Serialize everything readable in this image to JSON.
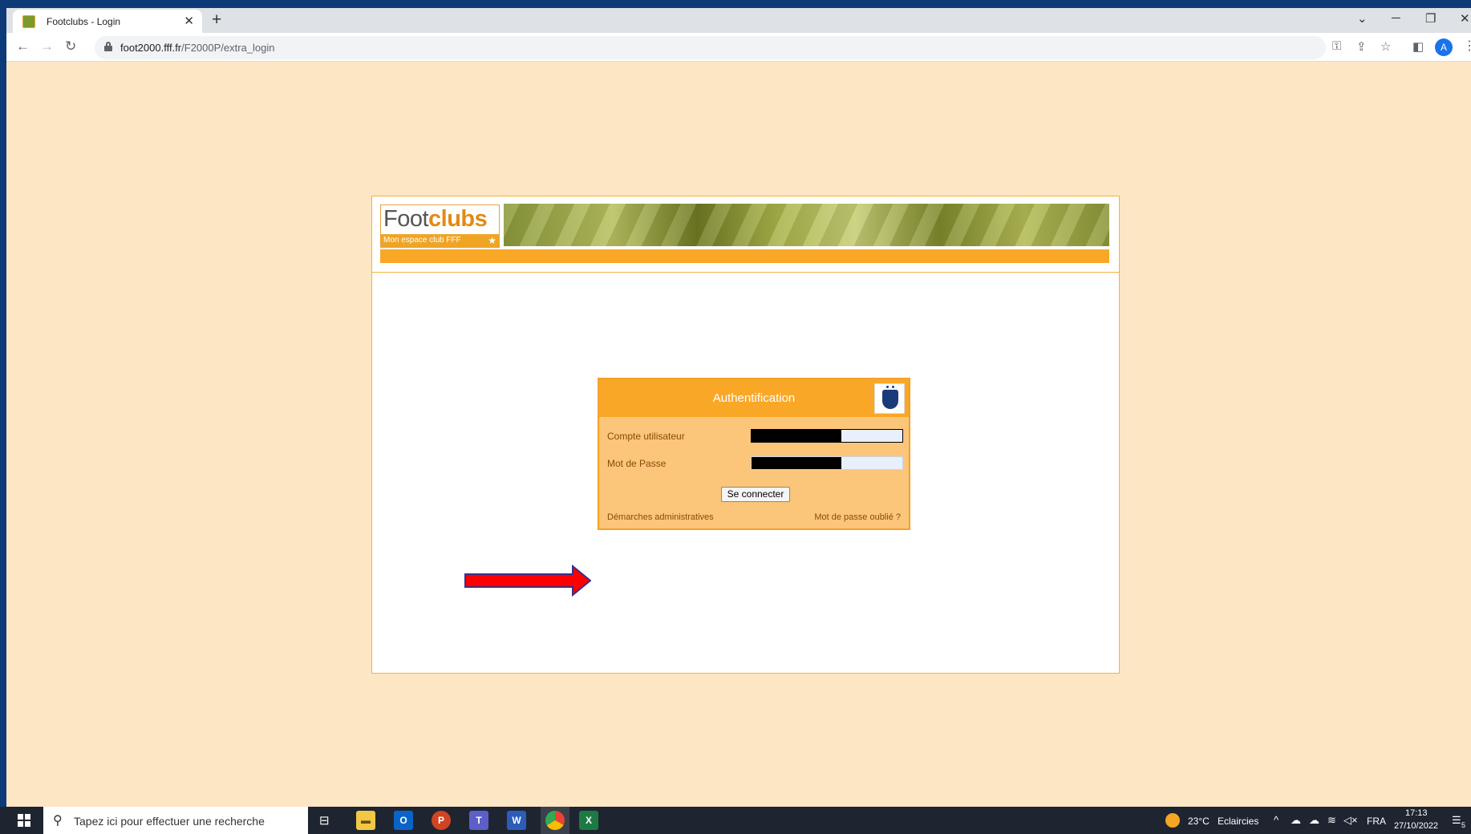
{
  "browser": {
    "tab_title": "Footclubs - Login",
    "tab_close": "✕",
    "new_tab": "+",
    "url_host": "foot2000.fff.fr",
    "url_path": "/F2000P/extra_login",
    "avatar_letter": "A"
  },
  "header": {
    "logo_foot": "Foot",
    "logo_clubs": "clubs",
    "logo_tagline": "Mon espace club FFF"
  },
  "login": {
    "title": "Authentification",
    "username_label": "Compte utilisateur",
    "password_label": "Mot de Passe",
    "submit_label": "Se connecter",
    "admin_link": "Démarches administratives",
    "forgot_link": "Mot de passe oublié ?"
  },
  "taskbar": {
    "search_placeholder": "Tapez ici pour effectuer une recherche",
    "weather_temp": "23°C",
    "weather_desc": "Eclaircies",
    "language": "FRA",
    "time": "17:13",
    "date": "27/10/2022",
    "notification_count": "5"
  },
  "colors": {
    "page_bg": "#fde6c3",
    "accent_orange": "#f9a726",
    "arrow_red": "#ff0000"
  }
}
